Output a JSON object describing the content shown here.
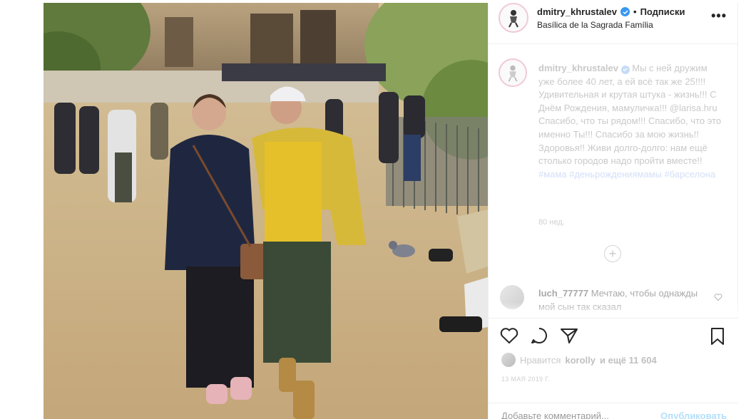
{
  "header": {
    "username": "dmitry_khrustalev",
    "separator": "•",
    "follow_label": "Подписки",
    "location": "Basílica de la Sagrada Família",
    "more_label": "•••"
  },
  "caption": {
    "username": "dmitry_khrustalev",
    "text_before": " Мы с ней дружим уже более 40 лет, а ей всё так же 25!!!! Удивительная и крутая штука - жизнь!!! С Днём Рождения, мамуличка!!! @larisa.hru Спасибо, что ты рядом!!! Спасибо, что это именно Ты!!! Спасибо за мою жизнь!! Здоровья!! Живи долго-долго: нам ещё столько городов надо пройти вместе!! ",
    "tags": "#мама #деньрождениямамы #барселона",
    "time": "80 нед."
  },
  "load_more_label": "+",
  "comment": {
    "username": "luch_77777",
    "text": " Мечтаю, чтобы однажды мой сын так сказал"
  },
  "likes": {
    "prefix": "Нравится ",
    "user": "korolly",
    "suffix": " и ещё 11 604"
  },
  "date": "13 МАЯ 2019 Г.",
  "add_comment": {
    "placeholder": "Добавьте комментарий...",
    "post_label": "Опубликовать"
  },
  "colors": {
    "verified": "#3897f0",
    "post_button": "#b2dffc",
    "border": "#efefef"
  }
}
